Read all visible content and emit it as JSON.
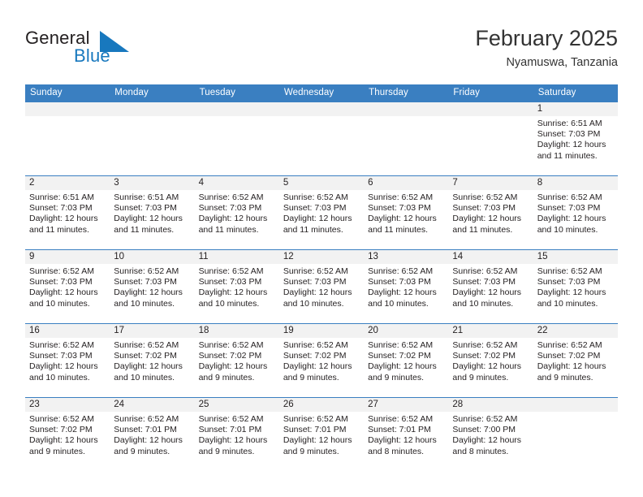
{
  "brand": {
    "name_part1": "General",
    "name_part2": "Blue",
    "logo_icon": "blue-triangle-flag-icon",
    "accent_color": "#1878be"
  },
  "header": {
    "title": "February 2025",
    "subtitle": "Nyamuswa, Tanzania"
  },
  "theme": {
    "header_row_color": "#3a7fc1",
    "week_divider_color": "#3a7fc1",
    "day_band_color": "#f2f2f2",
    "text_color": "#231f20"
  },
  "calendar": {
    "weekday_headers": [
      "Sunday",
      "Monday",
      "Tuesday",
      "Wednesday",
      "Thursday",
      "Friday",
      "Saturday"
    ],
    "weeks": [
      [
        {
          "day": "",
          "sunrise": "",
          "sunset": "",
          "daylight_line1": "",
          "daylight_line2": ""
        },
        {
          "day": "",
          "sunrise": "",
          "sunset": "",
          "daylight_line1": "",
          "daylight_line2": ""
        },
        {
          "day": "",
          "sunrise": "",
          "sunset": "",
          "daylight_line1": "",
          "daylight_line2": ""
        },
        {
          "day": "",
          "sunrise": "",
          "sunset": "",
          "daylight_line1": "",
          "daylight_line2": ""
        },
        {
          "day": "",
          "sunrise": "",
          "sunset": "",
          "daylight_line1": "",
          "daylight_line2": ""
        },
        {
          "day": "",
          "sunrise": "",
          "sunset": "",
          "daylight_line1": "",
          "daylight_line2": ""
        },
        {
          "day": "1",
          "sunrise": "Sunrise: 6:51 AM",
          "sunset": "Sunset: 7:03 PM",
          "daylight_line1": "Daylight: 12 hours",
          "daylight_line2": "and 11 minutes."
        }
      ],
      [
        {
          "day": "2",
          "sunrise": "Sunrise: 6:51 AM",
          "sunset": "Sunset: 7:03 PM",
          "daylight_line1": "Daylight: 12 hours",
          "daylight_line2": "and 11 minutes."
        },
        {
          "day": "3",
          "sunrise": "Sunrise: 6:51 AM",
          "sunset": "Sunset: 7:03 PM",
          "daylight_line1": "Daylight: 12 hours",
          "daylight_line2": "and 11 minutes."
        },
        {
          "day": "4",
          "sunrise": "Sunrise: 6:52 AM",
          "sunset": "Sunset: 7:03 PM",
          "daylight_line1": "Daylight: 12 hours",
          "daylight_line2": "and 11 minutes."
        },
        {
          "day": "5",
          "sunrise": "Sunrise: 6:52 AM",
          "sunset": "Sunset: 7:03 PM",
          "daylight_line1": "Daylight: 12 hours",
          "daylight_line2": "and 11 minutes."
        },
        {
          "day": "6",
          "sunrise": "Sunrise: 6:52 AM",
          "sunset": "Sunset: 7:03 PM",
          "daylight_line1": "Daylight: 12 hours",
          "daylight_line2": "and 11 minutes."
        },
        {
          "day": "7",
          "sunrise": "Sunrise: 6:52 AM",
          "sunset": "Sunset: 7:03 PM",
          "daylight_line1": "Daylight: 12 hours",
          "daylight_line2": "and 11 minutes."
        },
        {
          "day": "8",
          "sunrise": "Sunrise: 6:52 AM",
          "sunset": "Sunset: 7:03 PM",
          "daylight_line1": "Daylight: 12 hours",
          "daylight_line2": "and 10 minutes."
        }
      ],
      [
        {
          "day": "9",
          "sunrise": "Sunrise: 6:52 AM",
          "sunset": "Sunset: 7:03 PM",
          "daylight_line1": "Daylight: 12 hours",
          "daylight_line2": "and 10 minutes."
        },
        {
          "day": "10",
          "sunrise": "Sunrise: 6:52 AM",
          "sunset": "Sunset: 7:03 PM",
          "daylight_line1": "Daylight: 12 hours",
          "daylight_line2": "and 10 minutes."
        },
        {
          "day": "11",
          "sunrise": "Sunrise: 6:52 AM",
          "sunset": "Sunset: 7:03 PM",
          "daylight_line1": "Daylight: 12 hours",
          "daylight_line2": "and 10 minutes."
        },
        {
          "day": "12",
          "sunrise": "Sunrise: 6:52 AM",
          "sunset": "Sunset: 7:03 PM",
          "daylight_line1": "Daylight: 12 hours",
          "daylight_line2": "and 10 minutes."
        },
        {
          "day": "13",
          "sunrise": "Sunrise: 6:52 AM",
          "sunset": "Sunset: 7:03 PM",
          "daylight_line1": "Daylight: 12 hours",
          "daylight_line2": "and 10 minutes."
        },
        {
          "day": "14",
          "sunrise": "Sunrise: 6:52 AM",
          "sunset": "Sunset: 7:03 PM",
          "daylight_line1": "Daylight: 12 hours",
          "daylight_line2": "and 10 minutes."
        },
        {
          "day": "15",
          "sunrise": "Sunrise: 6:52 AM",
          "sunset": "Sunset: 7:03 PM",
          "daylight_line1": "Daylight: 12 hours",
          "daylight_line2": "and 10 minutes."
        }
      ],
      [
        {
          "day": "16",
          "sunrise": "Sunrise: 6:52 AM",
          "sunset": "Sunset: 7:03 PM",
          "daylight_line1": "Daylight: 12 hours",
          "daylight_line2": "and 10 minutes."
        },
        {
          "day": "17",
          "sunrise": "Sunrise: 6:52 AM",
          "sunset": "Sunset: 7:02 PM",
          "daylight_line1": "Daylight: 12 hours",
          "daylight_line2": "and 10 minutes."
        },
        {
          "day": "18",
          "sunrise": "Sunrise: 6:52 AM",
          "sunset": "Sunset: 7:02 PM",
          "daylight_line1": "Daylight: 12 hours",
          "daylight_line2": "and 9 minutes."
        },
        {
          "day": "19",
          "sunrise": "Sunrise: 6:52 AM",
          "sunset": "Sunset: 7:02 PM",
          "daylight_line1": "Daylight: 12 hours",
          "daylight_line2": "and 9 minutes."
        },
        {
          "day": "20",
          "sunrise": "Sunrise: 6:52 AM",
          "sunset": "Sunset: 7:02 PM",
          "daylight_line1": "Daylight: 12 hours",
          "daylight_line2": "and 9 minutes."
        },
        {
          "day": "21",
          "sunrise": "Sunrise: 6:52 AM",
          "sunset": "Sunset: 7:02 PM",
          "daylight_line1": "Daylight: 12 hours",
          "daylight_line2": "and 9 minutes."
        },
        {
          "day": "22",
          "sunrise": "Sunrise: 6:52 AM",
          "sunset": "Sunset: 7:02 PM",
          "daylight_line1": "Daylight: 12 hours",
          "daylight_line2": "and 9 minutes."
        }
      ],
      [
        {
          "day": "23",
          "sunrise": "Sunrise: 6:52 AM",
          "sunset": "Sunset: 7:02 PM",
          "daylight_line1": "Daylight: 12 hours",
          "daylight_line2": "and 9 minutes."
        },
        {
          "day": "24",
          "sunrise": "Sunrise: 6:52 AM",
          "sunset": "Sunset: 7:01 PM",
          "daylight_line1": "Daylight: 12 hours",
          "daylight_line2": "and 9 minutes."
        },
        {
          "day": "25",
          "sunrise": "Sunrise: 6:52 AM",
          "sunset": "Sunset: 7:01 PM",
          "daylight_line1": "Daylight: 12 hours",
          "daylight_line2": "and 9 minutes."
        },
        {
          "day": "26",
          "sunrise": "Sunrise: 6:52 AM",
          "sunset": "Sunset: 7:01 PM",
          "daylight_line1": "Daylight: 12 hours",
          "daylight_line2": "and 9 minutes."
        },
        {
          "day": "27",
          "sunrise": "Sunrise: 6:52 AM",
          "sunset": "Sunset: 7:01 PM",
          "daylight_line1": "Daylight: 12 hours",
          "daylight_line2": "and 8 minutes."
        },
        {
          "day": "28",
          "sunrise": "Sunrise: 6:52 AM",
          "sunset": "Sunset: 7:00 PM",
          "daylight_line1": "Daylight: 12 hours",
          "daylight_line2": "and 8 minutes."
        },
        {
          "day": "",
          "sunrise": "",
          "sunset": "",
          "daylight_line1": "",
          "daylight_line2": ""
        }
      ]
    ]
  }
}
